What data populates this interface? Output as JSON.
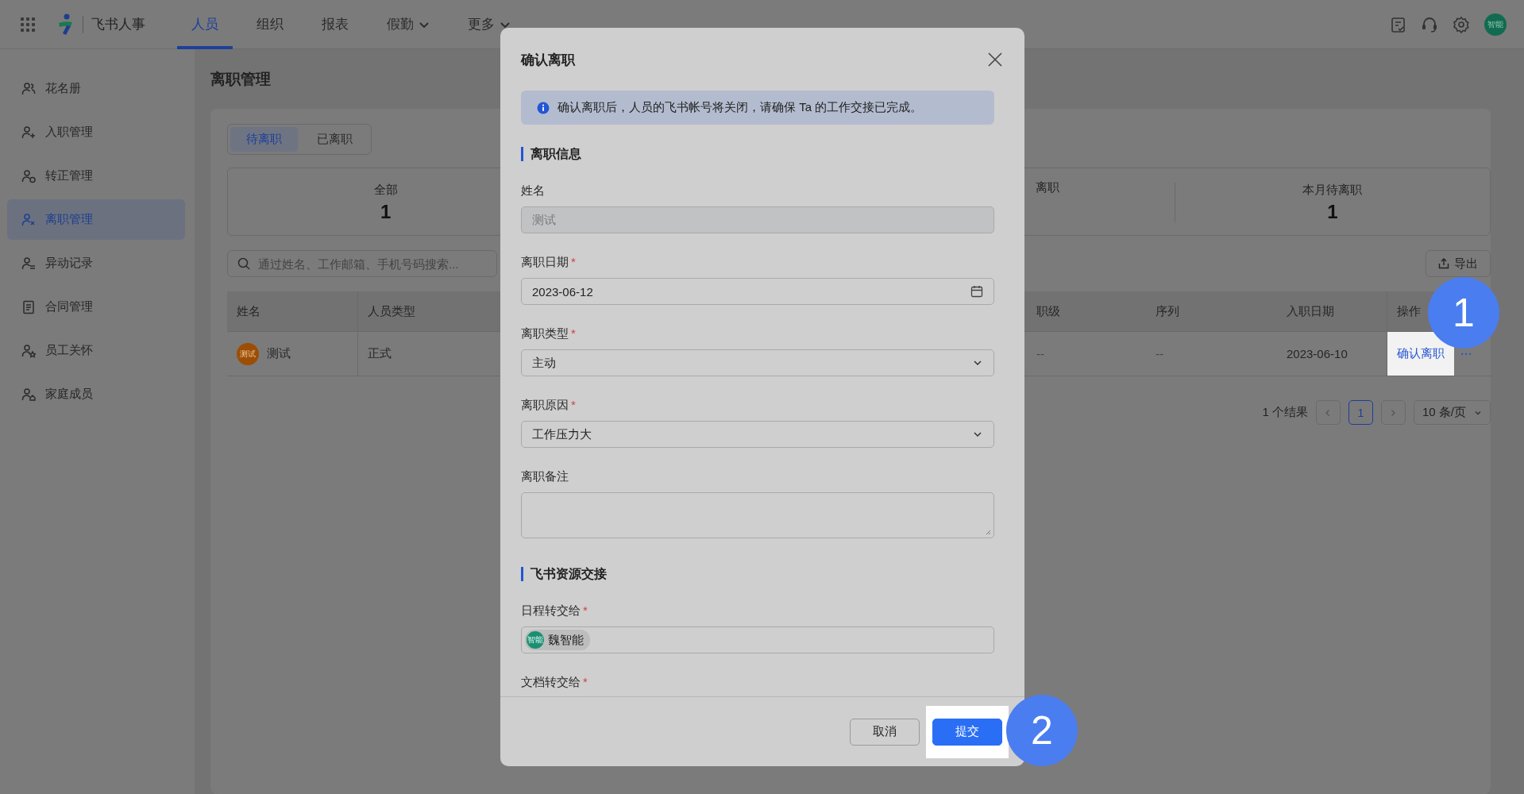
{
  "top_bar": {
    "app_name": "飞书人事",
    "nav": [
      {
        "label": "人员",
        "selected": true,
        "dropdown": false
      },
      {
        "label": "组织",
        "selected": false,
        "dropdown": false
      },
      {
        "label": "报表",
        "selected": false,
        "dropdown": false
      },
      {
        "label": "假勤",
        "selected": false,
        "dropdown": true
      },
      {
        "label": "更多",
        "selected": false,
        "dropdown": true
      }
    ],
    "avatar": "智能"
  },
  "sidebar": {
    "items": [
      {
        "label": "花名册",
        "selected": false
      },
      {
        "label": "入职管理",
        "selected": false
      },
      {
        "label": "转正管理",
        "selected": false
      },
      {
        "label": "离职管理",
        "selected": true
      },
      {
        "label": "异动记录",
        "selected": false
      },
      {
        "label": "合同管理",
        "selected": false
      },
      {
        "label": "员工关怀",
        "selected": false
      },
      {
        "label": "家庭成员",
        "selected": false
      }
    ]
  },
  "page": {
    "title": "离职管理",
    "tabs": [
      {
        "label": "待离职",
        "selected": true
      },
      {
        "label": "已离职",
        "selected": false
      }
    ],
    "stats": [
      {
        "label": "全部",
        "value": "1"
      },
      {
        "label": "离职"
      },
      {
        "label": "本月待离职",
        "value": "1"
      }
    ],
    "search": {
      "placeholder": "通过姓名、工作邮箱、手机号码搜索..."
    },
    "export_button": "导出",
    "table": {
      "columns": [
        "姓名",
        "人员类型",
        "职级",
        "序列",
        "入职日期",
        "操作"
      ],
      "rows": [
        {
          "avatar": "测试",
          "name": "测试",
          "type": "正式",
          "level": "--",
          "sequence": "--",
          "hire_date": "2023-06-10",
          "action": "确认离职",
          "more": "···"
        }
      ]
    },
    "pagination": {
      "total": "1 个结果",
      "pages": [
        {
          "label": "1",
          "selected": true
        }
      ],
      "page_size": "10 条/页"
    }
  },
  "dialog": {
    "title": "确认离职",
    "alert": "确认离职后，人员的飞书帐号将关闭，请确保 Ta 的工作交接已完成。",
    "sections": [
      {
        "title": "离职信息",
        "fields": [
          {
            "kind": "text",
            "label": "姓名",
            "disabled": true,
            "value": "测试"
          },
          {
            "kind": "date",
            "label": "离职日期",
            "required_mark": "*",
            "disabled": false,
            "value": "2023-06-12"
          },
          {
            "kind": "select",
            "label": "离职类型",
            "required_mark": "*",
            "disabled": false,
            "value": "主动"
          },
          {
            "kind": "select",
            "label": "离职原因",
            "required_mark": "*",
            "disabled": false,
            "value": "工作压力大"
          },
          {
            "kind": "textarea",
            "label": "离职备注",
            "disabled": false
          }
        ]
      },
      {
        "title": "飞书资源交接",
        "fields": [
          {
            "kind": "person",
            "label": "日程转交给",
            "required_mark": "*",
            "disabled": false,
            "person": {
              "avatar": "智能",
              "name": "魏智能"
            }
          },
          {
            "kind": "label",
            "label": "文档转交给",
            "required_mark": "*"
          }
        ]
      }
    ],
    "buttons": [
      {
        "label": "取消",
        "kind": "secondary"
      },
      {
        "label": "提交",
        "kind": "primary"
      }
    ]
  },
  "step_badges": [
    {
      "number": "1"
    },
    {
      "number": "2"
    }
  ]
}
